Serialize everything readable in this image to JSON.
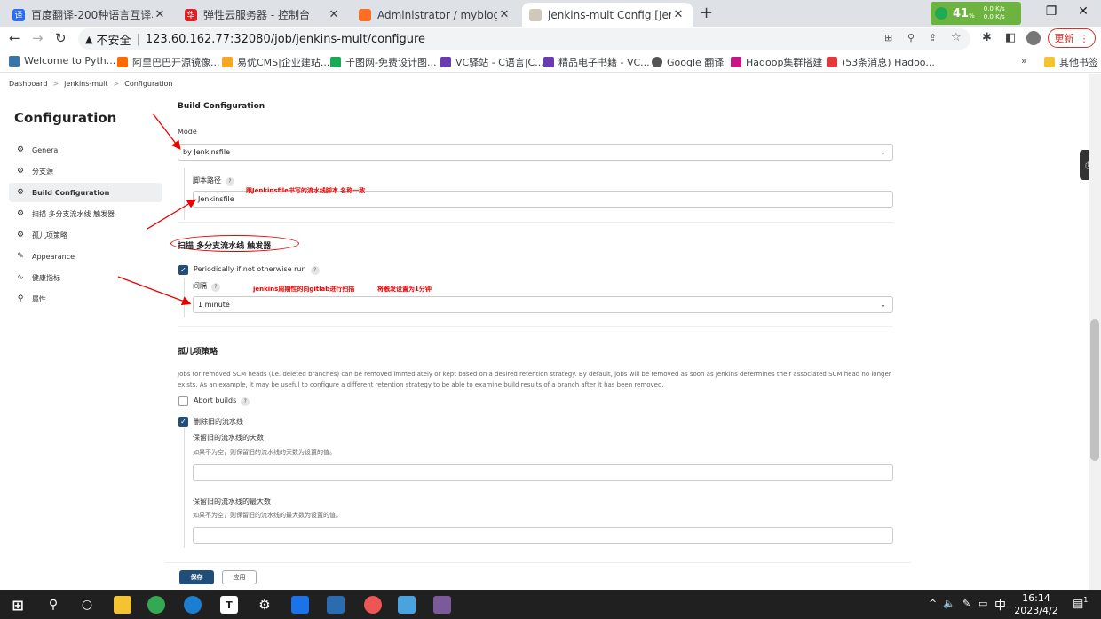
{
  "tabs": [
    {
      "label": "百度翻译-200种语言互译、沟通",
      "fav_color": "#2a6cf3",
      "fav_text": "译"
    },
    {
      "label": "弹性云服务器 - 控制台",
      "fav_color": "#e02020",
      "fav_text": "华"
    },
    {
      "label": "Administrator / myblog · GitLa",
      "fav_color": "#fc6d26",
      "fav_text": ""
    },
    {
      "label": "jenkins-mult Config [Jenkins]",
      "fav_color": "#d0c8b8",
      "fav_text": ""
    }
  ],
  "new_tab": "+",
  "extension": {
    "percent": "41",
    "unit": "%",
    "up": "0.0 K/s",
    "down": "0.0 K/s"
  },
  "address": {
    "security": "不安全",
    "url": "123.60.162.77:32080/job/jenkins-mult/configure"
  },
  "update_button": "更新",
  "bookmarks": [
    {
      "label": "Welcome to Pyth...",
      "color": "#3776ab"
    },
    {
      "label": "阿里巴巴开源镜像...",
      "color": "#ff6a00"
    },
    {
      "label": "易优CMS|企业建站...",
      "color": "#f5a623"
    },
    {
      "label": "千图网-免费设计图...",
      "color": "#1aaa55"
    },
    {
      "label": "VC驿站 - C语言|C...",
      "color": "#6a3ab2"
    },
    {
      "label": "精品电子书籍 - VC...",
      "color": "#6a3ab2"
    },
    {
      "label": "Google 翻译",
      "color": "#555555"
    },
    {
      "label": "Hadoop集群搭建",
      "color": "#c71585"
    },
    {
      "label": "(53条消息) Hadoo...",
      "color": "#e4393c"
    }
  ],
  "bookmarks_more": "»",
  "other_bookmarks": "其他书签",
  "breadcrumb": [
    "Dashboard",
    "jenkins-mult",
    "Configuration"
  ],
  "breadcrumb_sep": ">",
  "sidebar": {
    "title": "Configuration",
    "items": [
      {
        "label": "General",
        "icon": "⚙"
      },
      {
        "label": "分支源",
        "icon": "⚙"
      },
      {
        "label": "Build Configuration",
        "icon": "⚙"
      },
      {
        "label": "扫描 多分支流水线 触发器",
        "icon": "⚙"
      },
      {
        "label": "孤儿项策略",
        "icon": "⚙"
      },
      {
        "label": "Appearance",
        "icon": "✎"
      },
      {
        "label": "健康指标",
        "icon": "∿"
      },
      {
        "label": "属性",
        "icon": "⚲"
      }
    ]
  },
  "build_config": {
    "heading": "Build Configuration",
    "mode_label": "Mode",
    "mode_value": "by Jenkinsfile",
    "script_path_label": "脚本路径",
    "script_path_value": "Jenkinsfile"
  },
  "scan_trigger": {
    "heading": "扫描 多分支流水线 触发器",
    "periodic_label": "Periodically if not otherwise run",
    "interval_label": "间隔",
    "interval_value": "1 minute"
  },
  "orphan": {
    "heading": "孤儿项策略",
    "description": "Jobs for removed SCM heads (i.e. deleted branches) can be removed immediately or kept based on a desired retention strategy. By default, jobs will be removed as soon as Jenkins determines their associated SCM head no longer exists. As an example, it may be useful to configure a different retention strategy to be able to examine build results of a branch after it has been removed.",
    "abort_builds": "Abort builds",
    "discard_old": "删除旧的流水线",
    "days_label": "保留旧的流水线的天数",
    "days_help": "如果不为空，则保留旧的流水线的天数为设置的值。",
    "max_label": "保留旧的流水线的最大数",
    "max_help": "如果不为空，则保留旧的流水线的最大数为设置的值。"
  },
  "help_glyph": "?",
  "annotations": {
    "script_note": "跟Jenkinsfile书写的流水线脚本 名称一致",
    "scan_note": "jenkins周期性的向gitlab进行扫描",
    "interval_note": "将触发设置为1分钟"
  },
  "buttons": {
    "save": "保存",
    "apply": "应用"
  },
  "taskbar": {
    "ime": "中",
    "time": "16:14",
    "date": "2023/4/2",
    "notif": "1"
  }
}
